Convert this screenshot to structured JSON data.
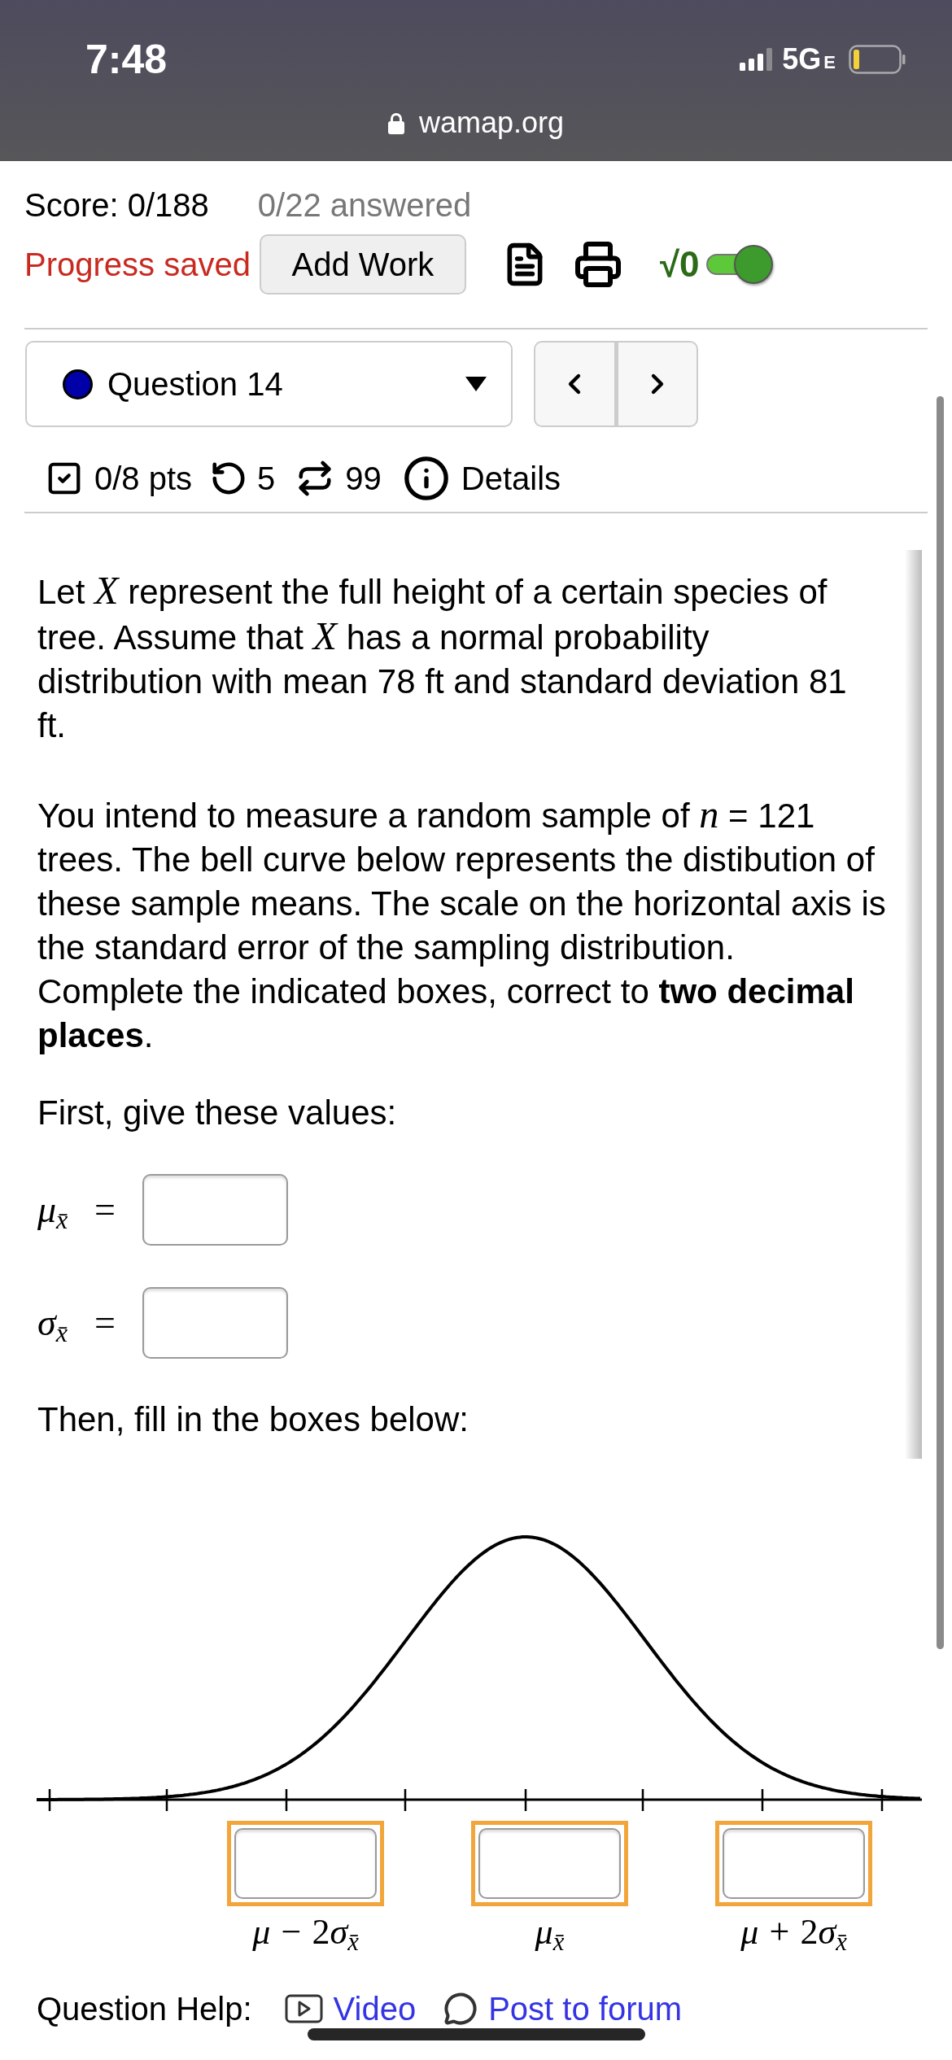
{
  "status_bar": {
    "time": "7:48",
    "network": "5G",
    "network_badge": "E"
  },
  "browser": {
    "url": "wamap.org"
  },
  "header": {
    "score": "Score: 0/188",
    "answered": "0/22 answered",
    "save_status": "Progress saved",
    "add_work_button": "Add Work",
    "math_toggle": {
      "label": "√0",
      "on": true
    }
  },
  "question_select": {
    "label": "Question 14"
  },
  "question_info": {
    "points": "0/8 pts",
    "attempts": "5",
    "regenerations": "99",
    "details": "Details"
  },
  "question": {
    "paragraphs": [
      "Let *X* represent the full height of a certain species of tree. Assume that *X* has a normal probability distribution with mean 78 ft and standard deviation 81 ft.",
      "You intend to measure a random sample of *n* = 121 trees. The bell curve below represents the distibution of these sample means. The scale on the horizontal axis is the standard error of the sampling distribution. Complete the indicated boxes, correct to **two decimal places**."
    ],
    "prompt_values": "First, give these values:",
    "value_fields": [
      {
        "label": [
          {
            "kind": "var",
            "text": "μ"
          },
          {
            "kind": "sub",
            "text": "x̄"
          }
        ],
        "relation": "="
      },
      {
        "label": [
          {
            "kind": "var",
            "text": "σ"
          },
          {
            "kind": "sub",
            "text": "x̄"
          }
        ],
        "relation": "="
      }
    ],
    "prompt_boxes": "Then, fill in the boxes below:"
  },
  "figure": {
    "answer_boxes": [
      {
        "label": [
          {
            "kind": "var",
            "text": "μ"
          },
          {
            "kind": "op",
            "text": "−"
          },
          {
            "kind": "num",
            "text": "2"
          },
          {
            "kind": "var",
            "text": "σ"
          },
          {
            "kind": "sub",
            "text": "x̄"
          }
        ],
        "highlighted": true
      },
      {
        "label": [
          {
            "kind": "var",
            "text": "μ"
          },
          {
            "kind": "sub",
            "text": "x̄"
          }
        ],
        "highlighted": true
      },
      {
        "label": [
          {
            "kind": "var",
            "text": "μ"
          },
          {
            "kind": "op",
            "text": "+"
          },
          {
            "kind": "num",
            "text": "2"
          },
          {
            "kind": "var",
            "text": "σ"
          },
          {
            "kind": "sub",
            "text": "x̄"
          }
        ],
        "highlighted": true
      }
    ]
  },
  "help": {
    "label": "Question Help:",
    "links": [
      {
        "kind": "video",
        "label": "Video"
      },
      {
        "kind": "forum",
        "label": "Post to forum"
      }
    ]
  }
}
